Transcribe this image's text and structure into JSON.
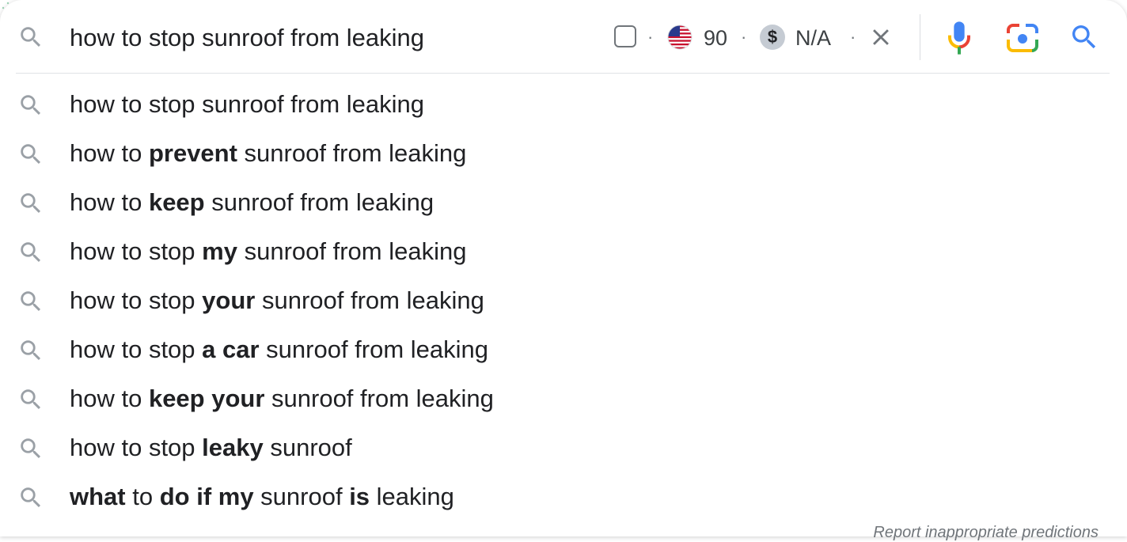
{
  "search": {
    "query": "how to stop sunroof from leaking",
    "volume": "90",
    "cpc": "N/A",
    "separator": "·"
  },
  "icons": {
    "lead": "search-icon",
    "flag": "us-flag-icon",
    "currency": "dollar-icon",
    "clear": "close-icon",
    "voice": "microphone-icon",
    "lens": "camera-lens-icon",
    "submit": "search-icon"
  },
  "colors": {
    "text": "#202124",
    "icon_gray": "#70757a",
    "google_blue": "#4285f4",
    "google_red": "#ea4335",
    "google_yellow": "#fbbc04",
    "google_green": "#34a853",
    "divider": "#e0e2e5"
  },
  "currency_symbol": "$",
  "suggestions": [
    [
      {
        "t": "how to stop sunroof from leaking",
        "b": false
      }
    ],
    [
      {
        "t": "how to ",
        "b": false
      },
      {
        "t": "prevent",
        "b": true
      },
      {
        "t": " sunroof from leaking",
        "b": false
      }
    ],
    [
      {
        "t": "how to ",
        "b": false
      },
      {
        "t": "keep",
        "b": true
      },
      {
        "t": " sunroof from leaking",
        "b": false
      }
    ],
    [
      {
        "t": "how to stop ",
        "b": false
      },
      {
        "t": "my",
        "b": true
      },
      {
        "t": " sunroof from leaking",
        "b": false
      }
    ],
    [
      {
        "t": "how to stop ",
        "b": false
      },
      {
        "t": "your",
        "b": true
      },
      {
        "t": " sunroof from leaking",
        "b": false
      }
    ],
    [
      {
        "t": "how to stop ",
        "b": false
      },
      {
        "t": "a car",
        "b": true
      },
      {
        "t": " sunroof from leaking",
        "b": false
      }
    ],
    [
      {
        "t": "how to ",
        "b": false
      },
      {
        "t": "keep your",
        "b": true
      },
      {
        "t": " sunroof from leaking",
        "b": false
      }
    ],
    [
      {
        "t": "how to stop ",
        "b": false
      },
      {
        "t": "leaky",
        "b": true
      },
      {
        "t": " sunroof",
        "b": false
      }
    ],
    [
      {
        "t": "what",
        "b": true
      },
      {
        "t": " to ",
        "b": false
      },
      {
        "t": "do if my",
        "b": true
      },
      {
        "t": " sunroof ",
        "b": false
      },
      {
        "t": "is",
        "b": true
      },
      {
        "t": " leaking",
        "b": false
      }
    ]
  ],
  "footer": {
    "report_label": "Report inappropriate predictions"
  }
}
